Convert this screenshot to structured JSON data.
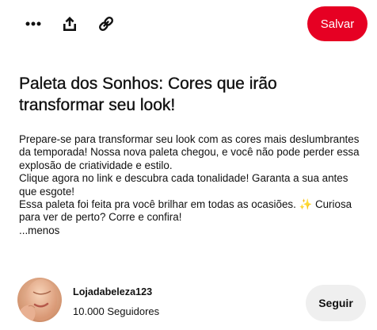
{
  "toolbar": {
    "icons": [
      "more-icon",
      "share-icon",
      "link-icon"
    ],
    "save_label": "Salvar"
  },
  "pin": {
    "title": "Paleta dos Sonhos: Cores que irão transformar seu look!",
    "description": [
      "Prepare-se para transformar seu look com as cores mais deslumbrantes da temporada! Nossa nova paleta chegou, e você não pode perder essa explosão de criatividade e estilo.",
      "Clique agora no link e descubra cada tonalidade! Garanta a sua antes que esgote!",
      "Essa paleta foi feita pra você brilhar em todas as ocasiões. ✨ Curiosa para ver de perto? Corre e confira!"
    ],
    "less_label": "...menos"
  },
  "creator": {
    "name": "Lojadabeleza123",
    "followers": "10.000 Seguidores",
    "follow_label": "Seguir"
  },
  "colors": {
    "brand_red": "#e60023",
    "follow_bg": "#efefef",
    "text": "#111111"
  }
}
